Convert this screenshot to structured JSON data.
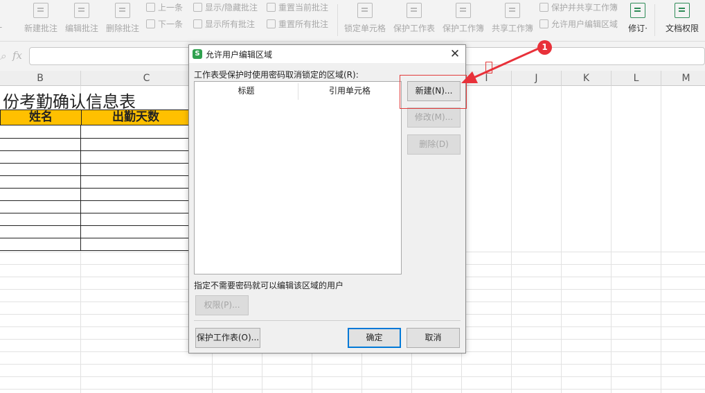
{
  "ribbon": {
    "buttons": [
      {
        "label": "新建批注",
        "icon": "new-comment-icon"
      },
      {
        "label": "编辑批注",
        "icon": "edit-comment-icon"
      },
      {
        "label": "删除批注",
        "icon": "delete-comment-icon"
      },
      {
        "label": "锁定单元格",
        "icon": "lock-cell-icon"
      },
      {
        "label": "保护工作表",
        "icon": "protect-sheet-icon"
      },
      {
        "label": "保护工作簿",
        "icon": "protect-workbook-icon"
      },
      {
        "label": "共享工作簿",
        "icon": "share-workbook-icon"
      },
      {
        "label": "修订·",
        "icon": "track-changes-icon"
      },
      {
        "label": "文档权限",
        "icon": "doc-permission-icon"
      }
    ],
    "small": [
      {
        "label": "上一条",
        "icon": "prev-comment-icon"
      },
      {
        "label": "下一条",
        "icon": "next-comment-icon"
      },
      {
        "label": "显示/隐藏批注",
        "icon": "toggle-comments-icon"
      },
      {
        "label": "显示所有批注",
        "icon": "show-all-comments-icon"
      },
      {
        "label": "重置当前批注",
        "icon": "reset-comment-icon"
      },
      {
        "label": "重置所有批注",
        "icon": "reset-all-comments-icon"
      },
      {
        "label": "保护并共享工作簿",
        "icon": "protect-share-icon"
      },
      {
        "label": "允许用户编辑区域",
        "icon": "allow-edit-ranges-icon"
      }
    ]
  },
  "formula_bar": {
    "fx": "fx"
  },
  "columns": [
    "B",
    "C",
    "I",
    "J",
    "K",
    "L",
    "M"
  ],
  "sheet": {
    "title": "份考勤确认信息表",
    "header_name": "姓名",
    "header_days": "出勤天数"
  },
  "dialog": {
    "title": "允许用户编辑区域",
    "app_icon": "S",
    "ranges_label": "工作表受保护时使用密码取消锁定的区域(R):",
    "list_col_title": "标题",
    "list_col_ref": "引用单元格",
    "new_button": "新建(N)...",
    "modify_button": "修改(M)...",
    "delete_button": "删除(D)",
    "users_label": "指定不需要密码就可以编辑该区域的用户",
    "permissions_button": "权限(P)...",
    "protect_sheet_button": "保护工作表(O)...",
    "ok_button": "确定",
    "cancel_button": "取消",
    "close_glyph": "✕"
  },
  "annotation": {
    "step": "1",
    "color": "#e23b3b"
  }
}
